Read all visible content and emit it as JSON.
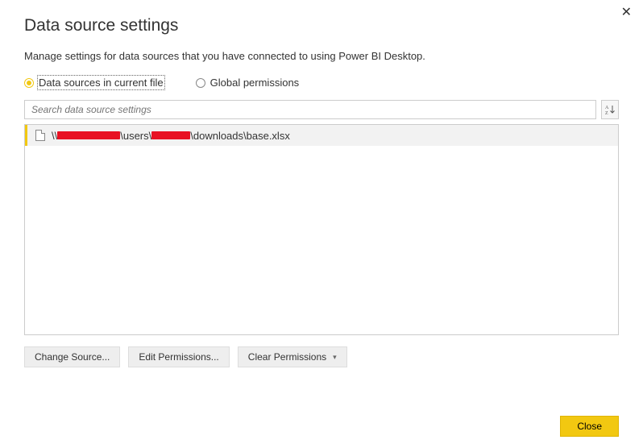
{
  "window": {
    "title": "Data source settings",
    "subtitle": "Manage settings for data sources that you have connected to using Power BI Desktop.",
    "close_glyph": "✕"
  },
  "radios": {
    "current_file": "Data sources in current file",
    "global": "Global permissions"
  },
  "search": {
    "placeholder": "Search data source settings",
    "sort_label": "A↓Z"
  },
  "sources": [
    {
      "prefix": "\\\\",
      "seg1_redacted_width": 78,
      "mid1": "\\users\\",
      "seg2_redacted_width": 48,
      "suffix": "\\downloads\\base.xlsx"
    }
  ],
  "buttons": {
    "change_source": "Change Source...",
    "edit_permissions": "Edit Permissions...",
    "clear_permissions": "Clear Permissions",
    "close": "Close"
  }
}
